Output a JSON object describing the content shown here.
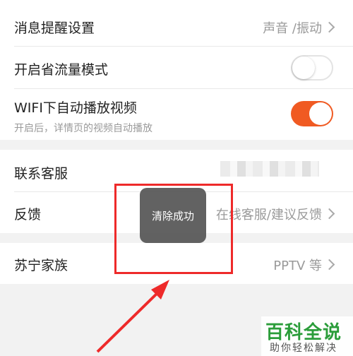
{
  "settings": {
    "msg_reminder": {
      "title": "消息提醒设置",
      "value": "声音 /振动"
    },
    "data_saver": {
      "title": "开启省流量模式",
      "enabled": false
    },
    "wifi_autoplay": {
      "title": "WIFI下自动播放视频",
      "subtitle": "开启后，详情页的视频自动播放",
      "enabled": true
    },
    "contact": {
      "title": "联系客服"
    },
    "feedback": {
      "title": "反馈",
      "value": "在线客服/建议反馈"
    },
    "family": {
      "title": "苏宁家族",
      "value": "PPTV 等"
    }
  },
  "toast": {
    "text": "清除成功"
  },
  "watermark": {
    "logo": "百科全说",
    "sub": "助你轻松解决"
  },
  "colors": {
    "accent": "#f05a22",
    "highlight": "#ee2a2a",
    "brand": "#2b9d3a"
  }
}
